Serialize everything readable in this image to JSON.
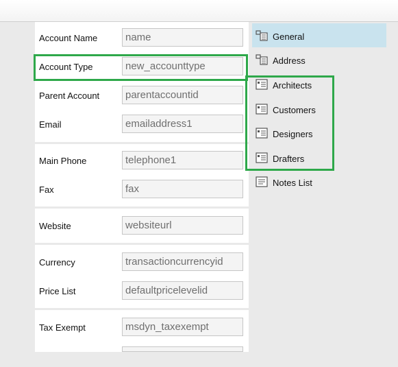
{
  "form": {
    "fields": [
      {
        "label": "Account Name",
        "value": "name"
      },
      {
        "label": "Account Type",
        "value": "new_accounttype"
      },
      {
        "label": "Parent Account",
        "value": "parentaccountid"
      },
      {
        "label": "Email",
        "value": "emailaddress1"
      },
      {
        "label": "Main Phone",
        "value": "telephone1"
      },
      {
        "label": "Fax",
        "value": "fax"
      },
      {
        "label": "Website",
        "value": "websiteurl"
      },
      {
        "label": "Currency",
        "value": "transactioncurrencyid"
      },
      {
        "label": "Price List",
        "value": "defaultpricelevelid"
      },
      {
        "label": "Tax Exempt",
        "value": "msdyn_taxexempt"
      }
    ]
  },
  "nav": {
    "items": [
      {
        "label": "General",
        "icon": "section-icon"
      },
      {
        "label": "Address",
        "icon": "section-icon"
      },
      {
        "label": "Architects",
        "icon": "subgrid-icon"
      },
      {
        "label": "Customers",
        "icon": "subgrid-icon"
      },
      {
        "label": "Designers",
        "icon": "subgrid-icon"
      },
      {
        "label": "Drafters",
        "icon": "subgrid-icon"
      },
      {
        "label": "Notes List",
        "icon": "notes-icon"
      }
    ],
    "active_item": "General"
  },
  "colors": {
    "highlight": "#2ea84a",
    "active_nav": "#c9e3ee",
    "field_bg": "#f4f4f4"
  }
}
